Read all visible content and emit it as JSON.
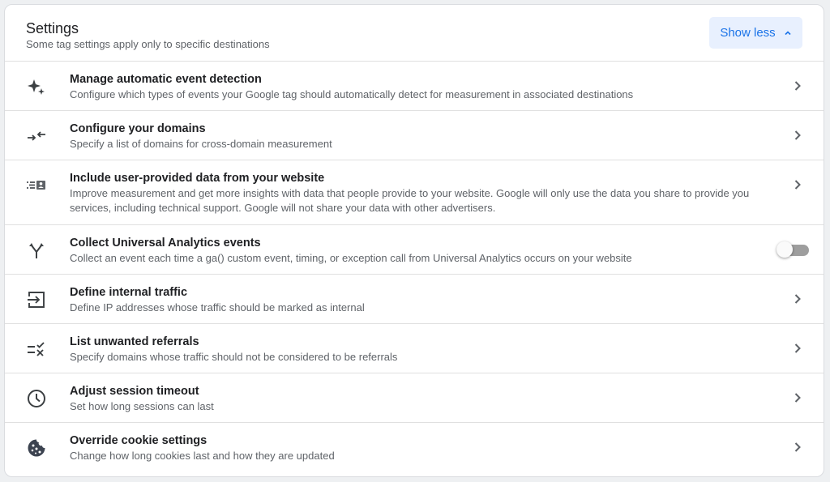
{
  "header": {
    "title": "Settings",
    "subtitle": "Some tag settings apply only to specific destinations",
    "toggle_button": {
      "label": "Show less",
      "icon": "chevron-up-icon"
    }
  },
  "colors": {
    "accent": "#1a73e8",
    "accent_bg": "#e8f0fe",
    "icon": "#5f6368",
    "toggle_off_track": "#9e9e9e"
  },
  "rows": [
    {
      "title": "Manage automatic event detection",
      "description": "Configure which types of events your Google tag should automatically detect for measurement in associated destinations",
      "icon": "sparkle-icon",
      "control": "chevron"
    },
    {
      "title": "Configure your domains",
      "description": "Specify a list of domains for cross-domain measurement",
      "icon": "arrows-inward-icon",
      "control": "chevron"
    },
    {
      "title": "Include user-provided data from your website",
      "description": "Improve measurement and get more insights with data that people provide to your website. Google will only use the data you share to provide you services, including technical support. Google will not share your data with other advertisers.",
      "icon": "user-data-icon",
      "control": "chevron"
    },
    {
      "title": "Collect Universal Analytics events",
      "description": "Collect an event each time a ga() custom event, timing, or exception call from Universal Analytics occurs on your website",
      "icon": "fork-arrows-icon",
      "control": "toggle",
      "toggle_on": false
    },
    {
      "title": "Define internal traffic",
      "description": "Define IP addresses whose traffic should be marked as internal",
      "icon": "login-icon",
      "control": "chevron"
    },
    {
      "title": "List unwanted referrals",
      "description": "Specify domains whose traffic should not be considered to be referrals",
      "icon": "rule-list-icon",
      "control": "chevron"
    },
    {
      "title": "Adjust session timeout",
      "description": "Set how long sessions can last",
      "icon": "clock-icon",
      "control": "chevron"
    },
    {
      "title": "Override cookie settings",
      "description": "Change how long cookies last and how they are updated",
      "icon": "cookie-icon",
      "control": "chevron"
    }
  ]
}
